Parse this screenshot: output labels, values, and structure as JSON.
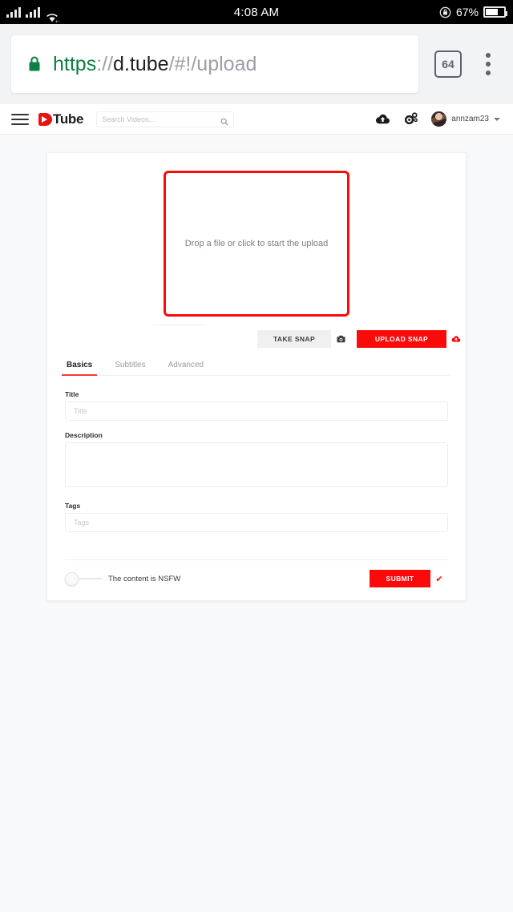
{
  "status_bar": {
    "time": "4:08 AM",
    "battery_percent": "67%",
    "signal_icon": "signal-bars-icon",
    "wifi_icon": "wifi-icon",
    "rotation_lock_icon": "rotation-lock-icon",
    "battery_icon": "battery-icon"
  },
  "browser": {
    "lock_icon": "lock-icon",
    "url": {
      "scheme": "https",
      "separator": "://",
      "host": "d.tube",
      "path": "/#!/upload"
    },
    "tab_count": "64",
    "menu_icon": "kebab-menu-icon"
  },
  "navbar": {
    "menu_icon": "hamburger-menu-icon",
    "logo_text": "Tube",
    "logo_mark": "dtube-play-logo-icon",
    "search": {
      "placeholder": "Search Videos...",
      "value": "",
      "icon": "search-icon"
    },
    "upload_icon": "cloud-upload-icon",
    "settings_icon": "gears-settings-icon",
    "avatar": "user-avatar",
    "username": "annzam23",
    "caret_icon": "chevron-down-icon"
  },
  "upload": {
    "dropzone_text": "Drop a file or click to start the upload",
    "take_snap_label": "TAKE SNAP",
    "camera_icon": "camera-icon",
    "upload_snap_label": "UPLOAD SNAP",
    "upload_snap_icon": "cloud-upload-icon"
  },
  "tabs": [
    {
      "label": "Basics",
      "active": true
    },
    {
      "label": "Subtitles",
      "active": false
    },
    {
      "label": "Advanced",
      "active": false
    }
  ],
  "form": {
    "title": {
      "label": "Title",
      "placeholder": "Title",
      "value": ""
    },
    "description": {
      "label": "Description",
      "placeholder": "",
      "value": ""
    },
    "tags": {
      "label": "Tags",
      "placeholder": "Tags",
      "value": ""
    }
  },
  "footer": {
    "nsfw_label": "The content is NSFW",
    "nsfw_enabled": false,
    "submit_label": "SUBMIT",
    "check_icon": "✔"
  },
  "colors": {
    "accent_red": "#fb0a0a",
    "page_bg": "#f8f9fa",
    "chrome_bg": "#f1f3f4",
    "secure_green": "#0b8043"
  }
}
